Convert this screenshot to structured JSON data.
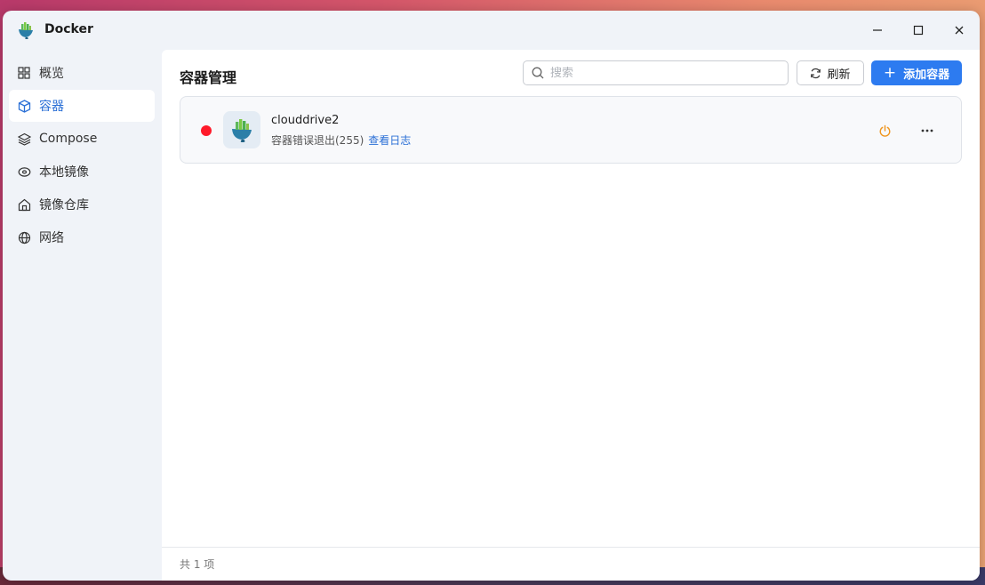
{
  "window": {
    "title": "Docker"
  },
  "sidebar": {
    "items": [
      {
        "label": "概览",
        "icon": "grid-icon",
        "active": false
      },
      {
        "label": "容器",
        "icon": "cube-icon",
        "active": true
      },
      {
        "label": "Compose",
        "icon": "layers-icon",
        "active": false
      },
      {
        "label": "本地镜像",
        "icon": "disk-icon",
        "active": false
      },
      {
        "label": "镜像仓库",
        "icon": "warehouse-icon",
        "active": false
      },
      {
        "label": "网络",
        "icon": "globe-icon",
        "active": false
      }
    ]
  },
  "main": {
    "title": "容器管理",
    "search": {
      "placeholder": "搜索",
      "value": ""
    },
    "refresh_label": "刷新",
    "add_label": "添加容器",
    "containers": [
      {
        "name": "clouddrive2",
        "status_text": "容器错误退出(255)",
        "log_link": "查看日志",
        "status_color": "#ff1a2a"
      }
    ],
    "footer_text": "共 1 项"
  },
  "colors": {
    "accent": "#2d7bf0",
    "power": "#f0961e",
    "error": "#ff1a2a"
  }
}
